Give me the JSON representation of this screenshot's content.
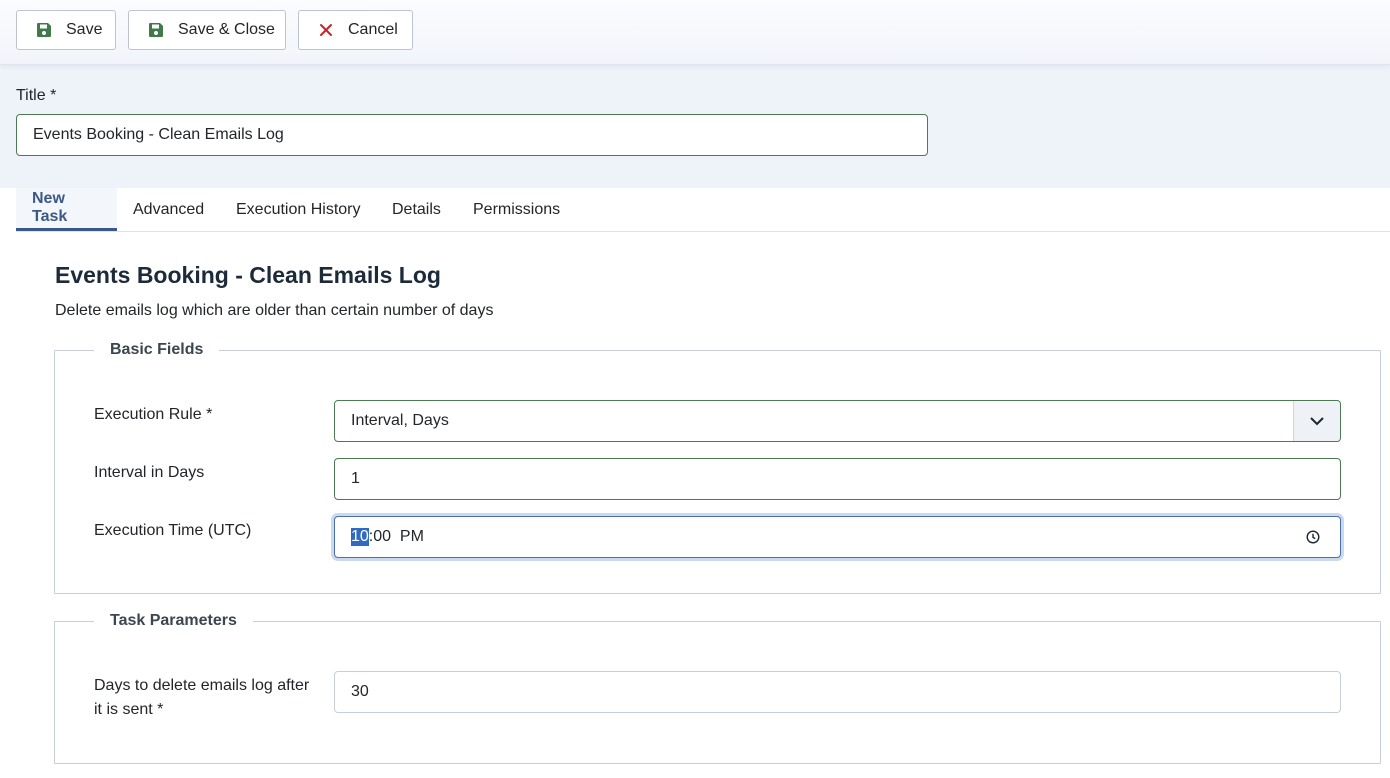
{
  "toolbar": {
    "save_label": "Save",
    "save_close_label": "Save & Close",
    "cancel_label": "Cancel"
  },
  "title_field": {
    "label": "Title *",
    "value": "Events Booking - Clean Emails Log"
  },
  "tabs": [
    {
      "label": "New Task",
      "active": true
    },
    {
      "label": "Advanced"
    },
    {
      "label": "Execution History"
    },
    {
      "label": "Details"
    },
    {
      "label": "Permissions"
    }
  ],
  "task": {
    "heading": "Events Booking - Clean Emails Log",
    "description": "Delete emails log which are older than certain number of days"
  },
  "basic_fields": {
    "legend": "Basic Fields",
    "execution_rule_label": "Execution Rule *",
    "execution_rule_value": "Interval, Days",
    "interval_label": "Interval in Days",
    "interval_value": "1",
    "time_label": "Execution Time (UTC)",
    "time_hour": "10",
    "time_rest": ":00  PM"
  },
  "task_parameters": {
    "legend": "Task Parameters",
    "days_label_line1": "Days to delete emails log after",
    "days_label_line2": "it is sent *",
    "days_value": "30"
  },
  "colors": {
    "accent": "#3b5988",
    "save_icon": "#3f7a48",
    "cancel_icon": "#c52427"
  }
}
